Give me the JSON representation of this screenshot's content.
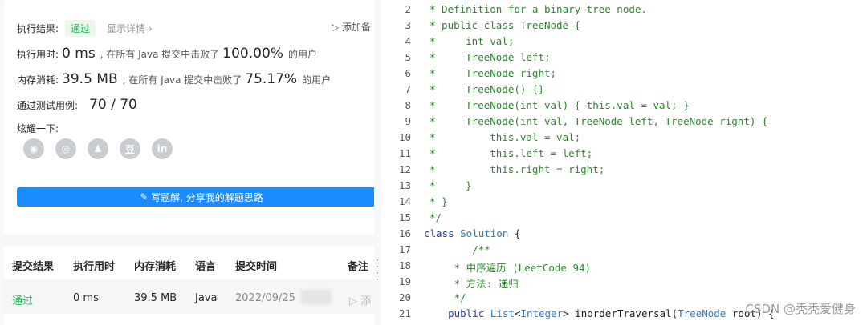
{
  "result": {
    "label": "执行结果:",
    "status": "通过",
    "details_link": "显示详情 ›",
    "add_note": "添加备",
    "runtime": {
      "label": "执行用时:",
      "value": "0 ms",
      "mid": ", 在所有 Java 提交中击败了",
      "percent": "100.00%",
      "suffix": "的用户"
    },
    "memory": {
      "label": "内存消耗:",
      "value": "39.5 MB",
      "mid": ", 在所有 Java 提交中击败了",
      "percent": "75.17%",
      "suffix": "的用户"
    },
    "tests": {
      "label": "通过测试用例:",
      "value": "70 / 70"
    },
    "share": {
      "label": "炫耀一下:",
      "icons": [
        "wechat-icon",
        "weibo-icon",
        "qq-icon",
        "douban-icon",
        "linkedin-icon"
      ],
      "icon_glyphs": [
        "◉",
        "◎",
        "♟",
        "豆",
        "in"
      ]
    },
    "write_solution": "写题解, 分享我的解题思路"
  },
  "submissions": {
    "headers": [
      "提交结果",
      "执行用时",
      "内存消耗",
      "语言",
      "提交时间",
      "备注"
    ],
    "row": {
      "result": "通过",
      "runtime": "0 ms",
      "memory": "39.5 MB",
      "language": "Java",
      "time": "2022/09/25",
      "note": "添"
    }
  },
  "code": {
    "lines": [
      {
        "no": "2",
        "parts": [
          {
            "c": "cm",
            "t": "* Definition for a binary tree node."
          }
        ]
      },
      {
        "no": "3",
        "parts": [
          {
            "c": "cm",
            "t": "* public class TreeNode {"
          }
        ]
      },
      {
        "no": "4",
        "parts": [
          {
            "c": "cm",
            "t": "*     int val;"
          }
        ]
      },
      {
        "no": "5",
        "parts": [
          {
            "c": "cm",
            "t": "*     TreeNode left;"
          }
        ]
      },
      {
        "no": "6",
        "parts": [
          {
            "c": "cm",
            "t": "*     TreeNode right;"
          }
        ]
      },
      {
        "no": "7",
        "parts": [
          {
            "c": "cm",
            "t": "*     TreeNode() {}"
          }
        ]
      },
      {
        "no": "8",
        "parts": [
          {
            "c": "cm",
            "t": "*     TreeNode(int val) { this.val = val; }"
          }
        ]
      },
      {
        "no": "9",
        "parts": [
          {
            "c": "cm",
            "t": "*     TreeNode(int val, TreeNode left, TreeNode right) {"
          }
        ]
      },
      {
        "no": "10",
        "parts": [
          {
            "c": "cm",
            "t": "*         this.val = val;"
          }
        ]
      },
      {
        "no": "11",
        "parts": [
          {
            "c": "cm",
            "t": "*         this.left = left;"
          }
        ]
      },
      {
        "no": "12",
        "parts": [
          {
            "c": "cm",
            "t": "*         this.right = right;"
          }
        ]
      },
      {
        "no": "13",
        "parts": [
          {
            "c": "cm",
            "t": "*     }"
          }
        ]
      },
      {
        "no": "14",
        "parts": [
          {
            "c": "cm",
            "t": "* }"
          }
        ]
      },
      {
        "no": "15",
        "parts": [
          {
            "c": "cm",
            "t": "*/"
          }
        ]
      },
      {
        "no": "16",
        "parts": [
          {
            "c": "kw",
            "t": "class "
          },
          {
            "c": "ty",
            "t": "Solution"
          },
          {
            "c": "pl",
            "t": " {"
          }
        ]
      },
      {
        "no": "17",
        "parts": [
          {
            "c": "cm",
            "t": "        /**"
          }
        ]
      },
      {
        "no": "18",
        "parts": [
          {
            "c": "cm",
            "t": "     * 中序遍历 (LeetCode 94)"
          }
        ]
      },
      {
        "no": "19",
        "parts": [
          {
            "c": "cm",
            "t": "     * 方法: 递归"
          }
        ]
      },
      {
        "no": "20",
        "parts": [
          {
            "c": "cm",
            "t": "     */"
          }
        ]
      },
      {
        "no": "21",
        "parts": [
          {
            "c": "kw",
            "t": "    public "
          },
          {
            "c": "ty",
            "t": "List"
          },
          {
            "c": "pl",
            "t": "<"
          },
          {
            "c": "ty",
            "t": "Integer"
          },
          {
            "c": "pl",
            "t": "> inorderTraversal("
          },
          {
            "c": "ty",
            "t": "TreeNode"
          },
          {
            "c": "pl",
            "t": " root) {"
          }
        ]
      }
    ],
    "indent": [
      1,
      1,
      1,
      1,
      1,
      1,
      1,
      1,
      1,
      1,
      1,
      1,
      1,
      1,
      0,
      0,
      0,
      0,
      0,
      0
    ]
  },
  "watermark": "CSDN @秃秃爱健身"
}
